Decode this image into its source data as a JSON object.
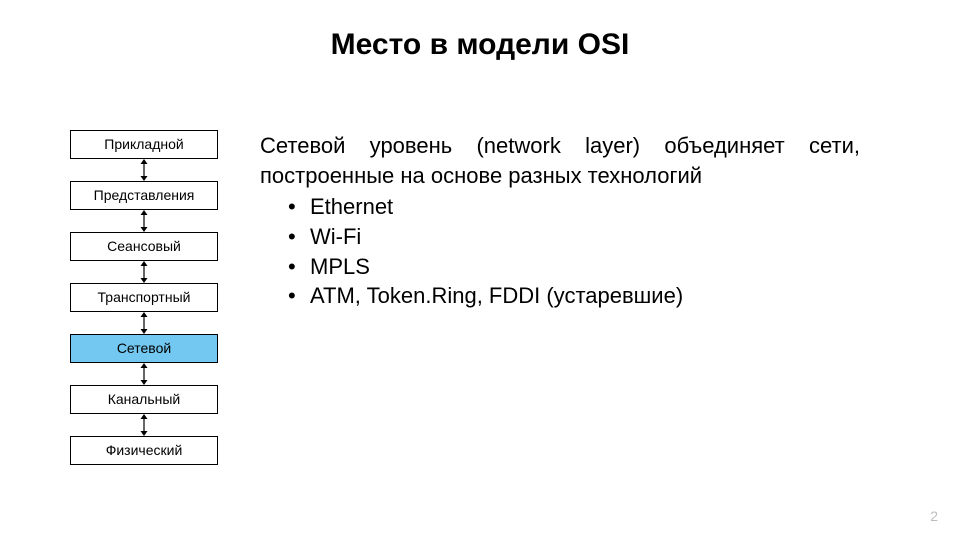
{
  "title": "Место в модели OSI",
  "layers": [
    {
      "label": "Прикладной",
      "highlight": false
    },
    {
      "label": "Представления",
      "highlight": false
    },
    {
      "label": "Сеансовый",
      "highlight": false
    },
    {
      "label": "Транспортный",
      "highlight": false
    },
    {
      "label": "Сетевой",
      "highlight": true
    },
    {
      "label": "Канальный",
      "highlight": false
    },
    {
      "label": "Физический",
      "highlight": false
    }
  ],
  "paragraph": "Сетевой уровень (network layer) объединяет сети, построенные на основе разных технологий",
  "bullets": [
    "Ethernet",
    "Wi-Fi",
    "MPLS",
    "ATM, Token.Ring, FDDI (устаревшие)"
  ],
  "page_number": "2"
}
